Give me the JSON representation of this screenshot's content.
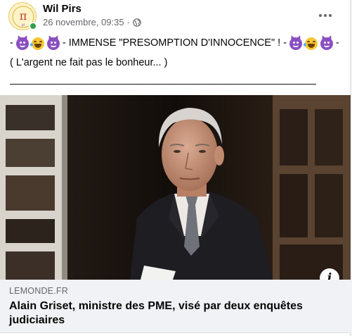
{
  "post": {
    "author": "Wil Pirs",
    "timestamp": "26 novembre, 09:35",
    "separator": "·",
    "privacy_icon": "globe-icon",
    "more_icon": "more-options-icon",
    "avatar_text": "π",
    "avatar_subtext": "pi"
  },
  "text": {
    "line1_emojis_left": [
      "smiling-imp",
      "rolling-laughing",
      "smiling-imp"
    ],
    "line1_prefix": "-",
    "line1_body": "- IMMENSE \"PRESOMPTION D'INNOCENCE\" ! -",
    "line1_suffix": "-",
    "line2": "( L'argent ne fait pas le bonheur... )",
    "line3": "______________________________________________________________"
  },
  "link": {
    "domain": "LEMONDE.FR",
    "headline": "Alain Griset, ministre des PME, visé par deux enquêtes judiciaires",
    "info_label": "i"
  },
  "colors": {
    "secondary_text": "#65676b",
    "link_background": "#f0f2f5",
    "online": "#31a24c"
  }
}
